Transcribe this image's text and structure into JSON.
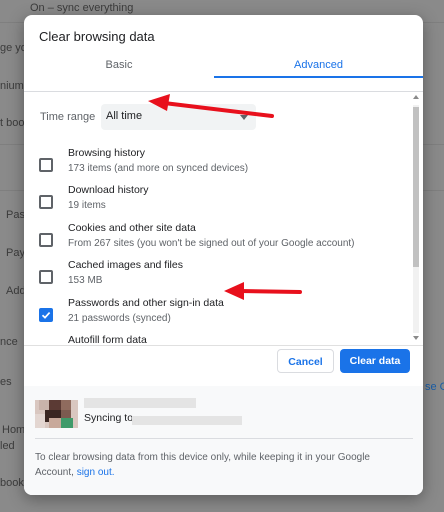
{
  "background": {
    "texts": [
      "On – sync everything",
      "ge yo",
      "nium",
      "t boo",
      "Pas",
      "Pay",
      "Add",
      "nce",
      "es",
      "Home",
      "led",
      "book"
    ],
    "link": "se G"
  },
  "dialog": {
    "title": "Clear browsing data",
    "tabs": [
      {
        "label": "Basic",
        "active": false
      },
      {
        "label": "Advanced",
        "active": true
      }
    ],
    "time_range": {
      "label": "Time range",
      "value": "All time"
    },
    "items": [
      {
        "title": "Browsing history",
        "subtitle": "173 items (and more on synced devices)",
        "checked": false
      },
      {
        "title": "Download history",
        "subtitle": "19 items",
        "checked": false
      },
      {
        "title": "Cookies and other site data",
        "subtitle": "From 267 sites (you won't be signed out of your Google account)",
        "checked": false
      },
      {
        "title": "Cached images and files",
        "subtitle": "153 MB",
        "checked": false
      },
      {
        "title": "Passwords and other sign-in data",
        "subtitle": "21 passwords (synced)",
        "checked": true
      },
      {
        "title": "Autofill form data",
        "subtitle": "",
        "checked": false
      }
    ],
    "buttons": {
      "cancel": "Cancel",
      "clear": "Clear data"
    },
    "sync": {
      "label": "Syncing to"
    },
    "note": {
      "text": "To clear browsing data from this device only, while keeping it in your Google Account, ",
      "link": "sign out."
    }
  },
  "colors": {
    "accent": "#1a73e8",
    "annotation_arrow": "#e8101c"
  }
}
